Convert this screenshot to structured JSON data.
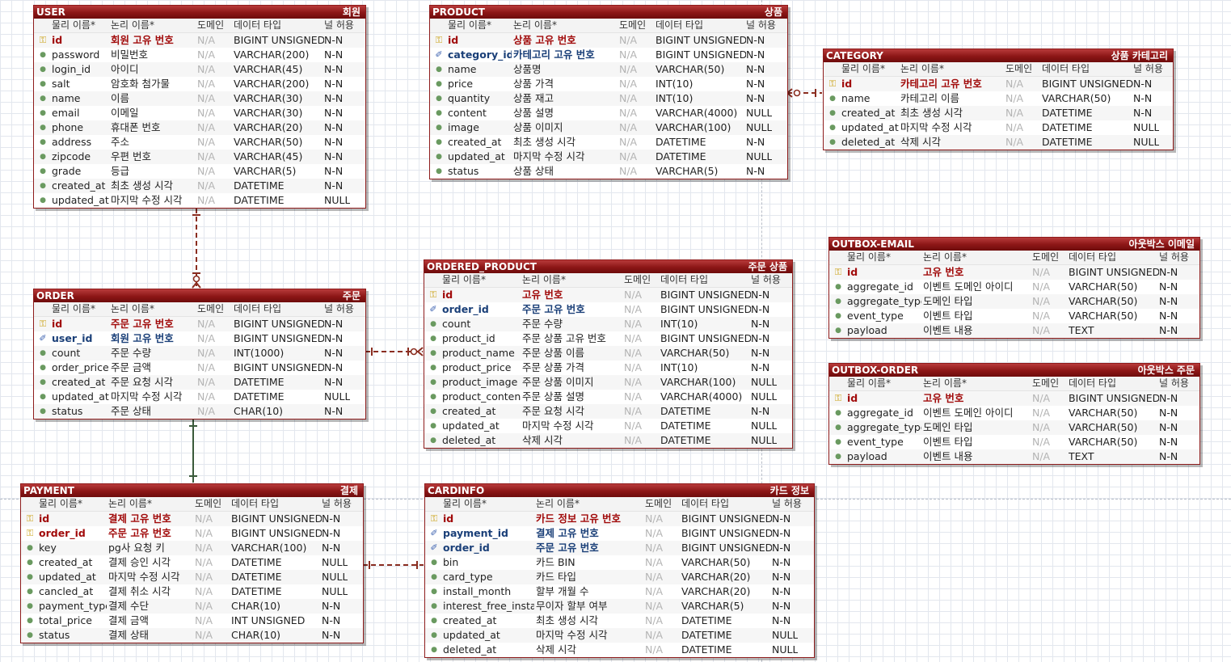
{
  "columns": {
    "physical": "물리 이름*",
    "logical": "논리 이름*",
    "domain": "도메인",
    "type": "데이터 타입",
    "nullable": "널 허용"
  },
  "icons": {
    "pk": "key-icon",
    "fk": "foreign-key-icon",
    "attr": "bullet-icon"
  },
  "colors": {
    "header": "#8c1616",
    "pk_text": "#a10b0b",
    "fk_text": "#1a3f78",
    "relation": "#8a2d20",
    "identifying": "#3a5a3a"
  },
  "entities": [
    {
      "id": "user",
      "physical": "USER",
      "logical": "회원",
      "rows": [
        {
          "k": "pk",
          "p": "id",
          "l": "회원 고유 번호",
          "d": "N/A",
          "t": "BIGINT UNSIGNED",
          "n": "N-N"
        },
        {
          "k": "",
          "p": "password",
          "l": "비밀번호",
          "d": "N/A",
          "t": "VARCHAR(200)",
          "n": "N-N"
        },
        {
          "k": "",
          "p": "login_id",
          "l": "아이디",
          "d": "N/A",
          "t": "VARCHAR(45)",
          "n": "N-N"
        },
        {
          "k": "",
          "p": "salt",
          "l": "암호화 첨가물",
          "d": "N/A",
          "t": "VARCHAR(200)",
          "n": "N-N"
        },
        {
          "k": "",
          "p": "name",
          "l": "이름",
          "d": "N/A",
          "t": "VARCHAR(30)",
          "n": "N-N"
        },
        {
          "k": "",
          "p": "email",
          "l": "이메일",
          "d": "N/A",
          "t": "VARCHAR(30)",
          "n": "N-N"
        },
        {
          "k": "",
          "p": "phone",
          "l": "휴대폰 번호",
          "d": "N/A",
          "t": "VARCHAR(20)",
          "n": "N-N"
        },
        {
          "k": "",
          "p": "address",
          "l": "주소",
          "d": "N/A",
          "t": "VARCHAR(50)",
          "n": "N-N"
        },
        {
          "k": "",
          "p": "zipcode",
          "l": "우편 번호",
          "d": "N/A",
          "t": "VARCHAR(45)",
          "n": "N-N"
        },
        {
          "k": "",
          "p": "grade",
          "l": "등급",
          "d": "N/A",
          "t": "VARCHAR(5)",
          "n": "N-N"
        },
        {
          "k": "",
          "p": "created_at",
          "l": "최초 생성 시각",
          "d": "N/A",
          "t": "DATETIME",
          "n": "N-N"
        },
        {
          "k": "",
          "p": "updated_at",
          "l": "마지막 수정 시각",
          "d": "N/A",
          "t": "DATETIME",
          "n": "NULL"
        }
      ]
    },
    {
      "id": "product",
      "physical": "PRODUCT",
      "logical": "상품",
      "rows": [
        {
          "k": "pk",
          "p": "id",
          "l": "상품 고유 번호",
          "d": "N/A",
          "t": "BIGINT UNSIGNED",
          "n": "N-N"
        },
        {
          "k": "fk",
          "p": "category_id",
          "l": "카테고리 고유 번호",
          "d": "N/A",
          "t": "BIGINT UNSIGNED",
          "n": "N-N"
        },
        {
          "k": "",
          "p": "name",
          "l": "상품명",
          "d": "N/A",
          "t": "VARCHAR(50)",
          "n": "N-N"
        },
        {
          "k": "",
          "p": "price",
          "l": "상품 가격",
          "d": "N/A",
          "t": "INT(10)",
          "n": "N-N"
        },
        {
          "k": "",
          "p": "quantity",
          "l": "상품 재고",
          "d": "N/A",
          "t": "INT(10)",
          "n": "N-N"
        },
        {
          "k": "",
          "p": "content",
          "l": "상품 설명",
          "d": "N/A",
          "t": "VARCHAR(4000)",
          "n": "NULL"
        },
        {
          "k": "",
          "p": "image",
          "l": "상품 이미지",
          "d": "N/A",
          "t": "VARCHAR(100)",
          "n": "NULL"
        },
        {
          "k": "",
          "p": "created_at",
          "l": "최초 생성 시각",
          "d": "N/A",
          "t": "DATETIME",
          "n": "N-N"
        },
        {
          "k": "",
          "p": "updated_at",
          "l": "마지막 수정 시각",
          "d": "N/A",
          "t": "DATETIME",
          "n": "NULL"
        },
        {
          "k": "",
          "p": "status",
          "l": "상품 상태",
          "d": "N/A",
          "t": "VARCHAR(5)",
          "n": "N-N"
        }
      ]
    },
    {
      "id": "category",
      "physical": "CATEGORY",
      "logical": "상품 카테고리",
      "rows": [
        {
          "k": "pk",
          "p": "id",
          "l": "카테고리 고유 번호",
          "d": "N/A",
          "t": "BIGINT UNSIGNED",
          "n": "N-N"
        },
        {
          "k": "",
          "p": "name",
          "l": "카테고리 이름",
          "d": "N/A",
          "t": "VARCHAR(50)",
          "n": "N-N"
        },
        {
          "k": "",
          "p": "created_at",
          "l": "최초 생성 시각",
          "d": "N/A",
          "t": "DATETIME",
          "n": "N-N"
        },
        {
          "k": "",
          "p": "updated_at",
          "l": "마지막 수정 시각",
          "d": "N/A",
          "t": "DATETIME",
          "n": "NULL"
        },
        {
          "k": "",
          "p": "deleted_at",
          "l": "삭제 시각",
          "d": "N/A",
          "t": "DATETIME",
          "n": "NULL"
        }
      ]
    },
    {
      "id": "outbox_email",
      "physical": "OUTBOX-EMAIL",
      "logical": "아웃박스 이메일",
      "rows": [
        {
          "k": "pk",
          "p": "id",
          "l": "고유 번호",
          "d": "N/A",
          "t": "BIGINT UNSIGNED",
          "n": "N-N"
        },
        {
          "k": "",
          "p": "aggregate_id",
          "l": "이벤트 도메인 아이디",
          "d": "N/A",
          "t": "VARCHAR(50)",
          "n": "N-N"
        },
        {
          "k": "",
          "p": "aggregate_type",
          "l": "도메인 타입",
          "d": "N/A",
          "t": "VARCHAR(50)",
          "n": "N-N"
        },
        {
          "k": "",
          "p": "event_type",
          "l": "이벤트 타입",
          "d": "N/A",
          "t": "VARCHAR(50)",
          "n": "N-N"
        },
        {
          "k": "",
          "p": "payload",
          "l": "이벤트 내용",
          "d": "N/A",
          "t": "TEXT",
          "n": "N-N"
        }
      ]
    },
    {
      "id": "outbox_order",
      "physical": "OUTBOX-ORDER",
      "logical": "아웃박스 주문",
      "rows": [
        {
          "k": "pk",
          "p": "id",
          "l": "고유 번호",
          "d": "N/A",
          "t": "BIGINT UNSIGNED",
          "n": "N-N"
        },
        {
          "k": "",
          "p": "aggregate_id",
          "l": "이벤트 도메인 아이디",
          "d": "N/A",
          "t": "VARCHAR(50)",
          "n": "N-N"
        },
        {
          "k": "",
          "p": "aggregate_type",
          "l": "도메인 타입",
          "d": "N/A",
          "t": "VARCHAR(50)",
          "n": "N-N"
        },
        {
          "k": "",
          "p": "event_type",
          "l": "이벤트 타입",
          "d": "N/A",
          "t": "VARCHAR(50)",
          "n": "N-N"
        },
        {
          "k": "",
          "p": "payload",
          "l": "이벤트 내용",
          "d": "N/A",
          "t": "TEXT",
          "n": "N-N"
        }
      ]
    },
    {
      "id": "order",
      "physical": "ORDER",
      "logical": "주문",
      "rows": [
        {
          "k": "pk",
          "p": "id",
          "l": "주문 고유 번호",
          "d": "N/A",
          "t": "BIGINT UNSIGNED",
          "n": "N-N"
        },
        {
          "k": "fk",
          "p": "user_id",
          "l": "회원 고유 번호",
          "d": "N/A",
          "t": "BIGINT UNSIGNED",
          "n": "N-N"
        },
        {
          "k": "",
          "p": "count",
          "l": "주문 수량",
          "d": "N/A",
          "t": "INT(1000)",
          "n": "N-N"
        },
        {
          "k": "",
          "p": "order_price",
          "l": "주문 금액",
          "d": "N/A",
          "t": "BIGINT UNSIGNED",
          "n": "N-N"
        },
        {
          "k": "",
          "p": "created_at",
          "l": "주문 요청 시각",
          "d": "N/A",
          "t": "DATETIME",
          "n": "N-N"
        },
        {
          "k": "",
          "p": "updated_at",
          "l": "마지막 수정 시각",
          "d": "N/A",
          "t": "DATETIME",
          "n": "NULL"
        },
        {
          "k": "",
          "p": "status",
          "l": "주문 상태",
          "d": "N/A",
          "t": "CHAR(10)",
          "n": "N-N"
        }
      ]
    },
    {
      "id": "ordered_product",
      "physical": "ORDERED_PRODUCT",
      "logical": "주문 상품",
      "rows": [
        {
          "k": "pk",
          "p": "id",
          "l": "고유 번호",
          "d": "N/A",
          "t": "BIGINT UNSIGNED",
          "n": "N-N"
        },
        {
          "k": "fk",
          "p": "order_id",
          "l": "주문 고유 번호",
          "d": "N/A",
          "t": "BIGINT UNSIGNED",
          "n": "N-N"
        },
        {
          "k": "",
          "p": "count",
          "l": "주문 수량",
          "d": "N/A",
          "t": "INT(10)",
          "n": "N-N"
        },
        {
          "k": "",
          "p": "product_id",
          "l": "주문 상품 고유 번호",
          "d": "N/A",
          "t": "BIGINT UNSIGNED",
          "n": "N-N"
        },
        {
          "k": "",
          "p": "product_name",
          "l": "주문 상품 이름",
          "d": "N/A",
          "t": "VARCHAR(50)",
          "n": "N-N"
        },
        {
          "k": "",
          "p": "product_price",
          "l": "주문 상품 가격",
          "d": "N/A",
          "t": "INT(10)",
          "n": "N-N"
        },
        {
          "k": "",
          "p": "product_image",
          "l": "주문 상품 이미지",
          "d": "N/A",
          "t": "VARCHAR(100)",
          "n": "NULL"
        },
        {
          "k": "",
          "p": "product_content",
          "l": "주문 상품 설명",
          "d": "N/A",
          "t": "VARCHAR(4000)",
          "n": "NULL"
        },
        {
          "k": "",
          "p": "created_at",
          "l": "주문 요청 시각",
          "d": "N/A",
          "t": "DATETIME",
          "n": "N-N"
        },
        {
          "k": "",
          "p": "updated_at",
          "l": "마지막 수정 시각",
          "d": "N/A",
          "t": "DATETIME",
          "n": "NULL"
        },
        {
          "k": "",
          "p": "deleted_at",
          "l": "삭제 시각",
          "d": "N/A",
          "t": "DATETIME",
          "n": "NULL"
        }
      ]
    },
    {
      "id": "payment",
      "physical": "PAYMENT",
      "logical": "결제",
      "rows": [
        {
          "k": "pk",
          "p": "id",
          "l": "결제 고유 번호",
          "d": "N/A",
          "t": "BIGINT UNSIGNED",
          "n": "N-N"
        },
        {
          "k": "pkfk",
          "p": "order_id",
          "l": "주문 고유 번호",
          "d": "N/A",
          "t": "BIGINT UNSIGNED",
          "n": "N-N"
        },
        {
          "k": "",
          "p": "key",
          "l": "pg사 요청 키",
          "d": "N/A",
          "t": "VARCHAR(100)",
          "n": "N-N"
        },
        {
          "k": "",
          "p": "created_at",
          "l": "결제 승인 시각",
          "d": "N/A",
          "t": "DATETIME",
          "n": "NULL"
        },
        {
          "k": "",
          "p": "updated_at",
          "l": "마지막 수정 시각",
          "d": "N/A",
          "t": "DATETIME",
          "n": "NULL"
        },
        {
          "k": "",
          "p": "cancled_at",
          "l": "결제 취소 시각",
          "d": "N/A",
          "t": "DATETIME",
          "n": "NULL"
        },
        {
          "k": "",
          "p": "payment_type",
          "l": "결제 수단",
          "d": "N/A",
          "t": "CHAR(10)",
          "n": "N-N"
        },
        {
          "k": "",
          "p": "total_price",
          "l": "결제 금액",
          "d": "N/A",
          "t": "INT UNSIGNED",
          "n": "N-N"
        },
        {
          "k": "",
          "p": "status",
          "l": "결제 상태",
          "d": "N/A",
          "t": "CHAR(10)",
          "n": "N-N"
        }
      ]
    },
    {
      "id": "cardinfo",
      "physical": "CARDINFO",
      "logical": "카드 정보",
      "rows": [
        {
          "k": "pk",
          "p": "id",
          "l": "카드 정보 고유 번호",
          "d": "N/A",
          "t": "BIGINT UNSIGNED",
          "n": "N-N"
        },
        {
          "k": "fk",
          "p": "payment_id",
          "l": "결제 고유 번호",
          "d": "N/A",
          "t": "BIGINT UNSIGNED",
          "n": "N-N"
        },
        {
          "k": "fk",
          "p": "order_id",
          "l": "주문 고유 번호",
          "d": "N/A",
          "t": "BIGINT UNSIGNED",
          "n": "N-N"
        },
        {
          "k": "",
          "p": "bin",
          "l": "카드 BIN",
          "d": "N/A",
          "t": "VARCHAR(50)",
          "n": "N-N"
        },
        {
          "k": "",
          "p": "card_type",
          "l": "카드 타입",
          "d": "N/A",
          "t": "VARCHAR(20)",
          "n": "N-N"
        },
        {
          "k": "",
          "p": "install_month",
          "l": "할부 개월 수",
          "d": "N/A",
          "t": "VARCHAR(20)",
          "n": "N-N"
        },
        {
          "k": "",
          "p": "interest_free_install",
          "l": "무이자 할부 여부",
          "d": "N/A",
          "t": "VARCHAR(5)",
          "n": "N-N"
        },
        {
          "k": "",
          "p": "created_at",
          "l": "최초 생성 시각",
          "d": "N/A",
          "t": "DATETIME",
          "n": "N-N"
        },
        {
          "k": "",
          "p": "updated_at",
          "l": "마지막 수정 시각",
          "d": "N/A",
          "t": "DATETIME",
          "n": "NULL"
        },
        {
          "k": "",
          "p": "deleted_at",
          "l": "삭제 시각",
          "d": "N/A",
          "t": "DATETIME",
          "n": "NULL"
        }
      ]
    }
  ]
}
